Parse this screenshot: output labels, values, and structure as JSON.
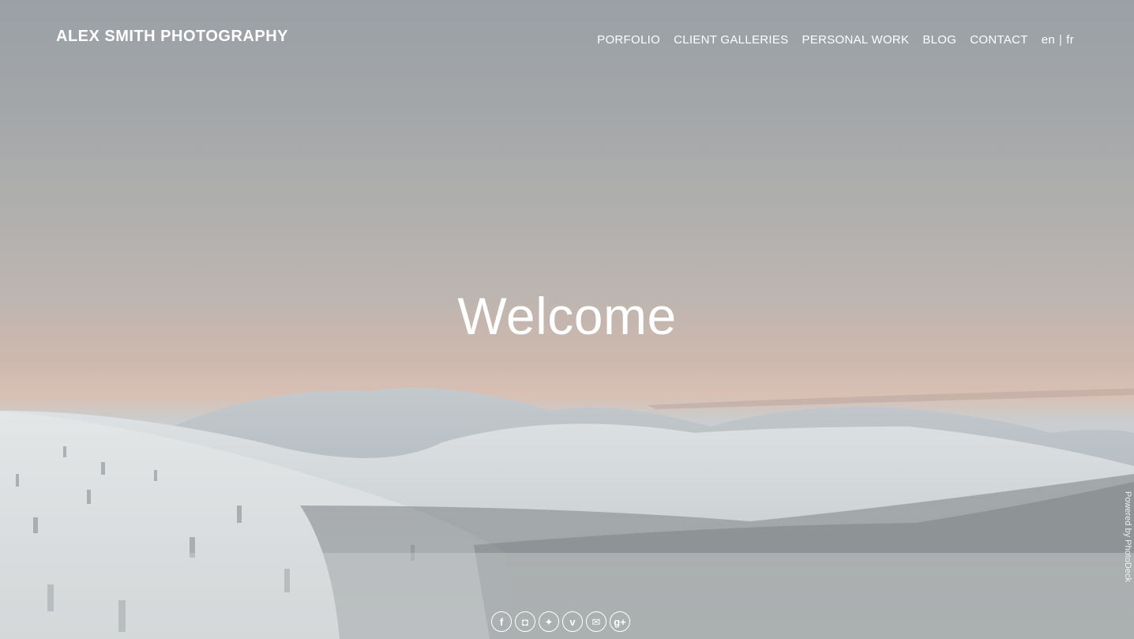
{
  "site": {
    "logo": "ALEX SMITH PHOTOGRAPHY"
  },
  "nav": {
    "items": [
      {
        "label": "PORFOLIO"
      },
      {
        "label": "CLIENT GALLERIES"
      },
      {
        "label": "PERSONAL WORK"
      },
      {
        "label": "BLOG"
      },
      {
        "label": "CONTACT"
      }
    ],
    "lang": {
      "en": "en",
      "sep": "|",
      "fr": "fr"
    }
  },
  "hero": {
    "title": "Welcome",
    "background": "snowy-fell-landscape-at-dusk"
  },
  "social": [
    {
      "icon": "facebook-icon",
      "glyph": "f"
    },
    {
      "icon": "instagram-icon",
      "glyph": "◘"
    },
    {
      "icon": "twitter-icon",
      "glyph": "✦"
    },
    {
      "icon": "vimeo-icon",
      "glyph": "v"
    },
    {
      "icon": "email-icon",
      "glyph": "✉"
    },
    {
      "icon": "google-plus-icon",
      "glyph": "g+"
    }
  ],
  "footer": {
    "powered_by": "Powered by PhotoDeck"
  },
  "colors": {
    "text": "#ffffff",
    "sky_top": "#9aa0a6",
    "horizon_glow": "#d8c0b4",
    "snow": "#dfe3e5",
    "trees": "#5a5f62"
  }
}
